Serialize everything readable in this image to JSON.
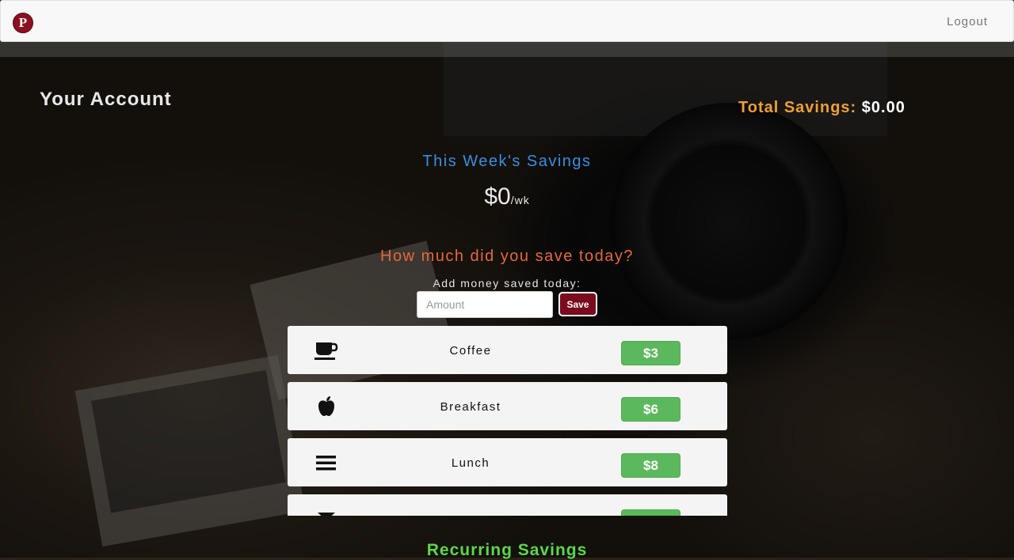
{
  "navbar": {
    "logo_letter": "P",
    "logout_label": "Logout"
  },
  "account": {
    "title": "Your Account",
    "total_label": "Total Savings:",
    "total_value": "$0.00"
  },
  "week": {
    "title": "This Week's Savings",
    "amount": "$0",
    "unit": "/wk"
  },
  "today": {
    "title": "How much did you save today?",
    "add_label": "Add money saved today:",
    "amount_placeholder": "Amount",
    "amount_value": "",
    "save_label": "Save"
  },
  "items": [
    {
      "icon": "coffee-cup-icon",
      "name": "Coffee",
      "price": "$3"
    },
    {
      "icon": "apple-icon",
      "name": "Breakfast",
      "price": "$6"
    },
    {
      "icon": "hamburger-menu-icon",
      "name": "Lunch",
      "price": "$8"
    },
    {
      "icon": "glass-icon",
      "name": "",
      "price": ""
    }
  ],
  "recurring_title": "Recurring Savings",
  "colors": {
    "week_title": "#3c8de0",
    "today_title": "#e8673a",
    "total_label": "#f0a030",
    "price_badge": "#5cb85c",
    "save_button": "#7a0b1c",
    "recurring_title": "#5bd84a"
  }
}
